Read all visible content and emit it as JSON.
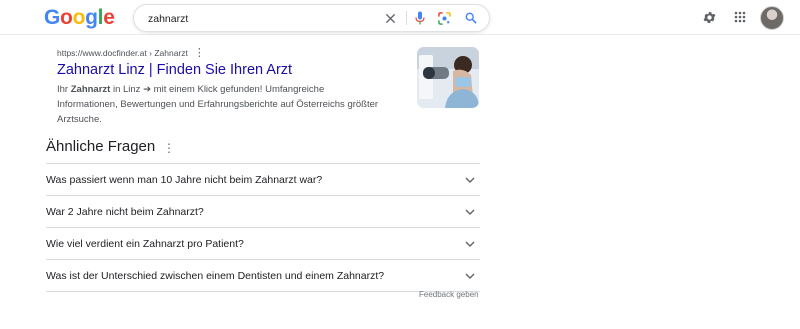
{
  "logo": {
    "letters": [
      "G",
      "o",
      "o",
      "g",
      "l",
      "e"
    ],
    "colors": [
      "#4285F4",
      "#EA4335",
      "#FBBC05",
      "#4285F4",
      "#34A853",
      "#EA4335"
    ]
  },
  "search": {
    "query": "zahnarzt"
  },
  "icons": {
    "clear": "close-icon",
    "voice": "microphone-icon",
    "lens": "google-lens-icon",
    "search": "search-icon",
    "settings": "gear-icon",
    "apps": "apps-grid-icon"
  },
  "result": {
    "url": "https://www.docfinder.at › Zahnarzt",
    "title": "Zahnarzt Linz | Finden Sie Ihren Arzt",
    "snippet_pre": "Ihr ",
    "snippet_bold": "Zahnarzt",
    "snippet_post": " in Linz ➔ mit einem Klick gefunden! Umfangreiche Informationen, Bewertungen und Erfahrungsberichte auf Österreichs größter Arztsuche."
  },
  "paa": {
    "title": "Ähnliche Fragen",
    "questions": [
      "Was passiert wenn man 10 Jahre nicht beim Zahnarzt war?",
      "War 2 Jahre nicht beim Zahnarzt?",
      "Wie viel verdient ein Zahnarzt pro Patient?",
      "Was ist der Unterschied zwischen einem Dentisten und einem Zahnarzt?"
    ]
  },
  "feedback": "Feedback geben",
  "colors": {
    "link": "#1a0dab",
    "accent": "#4285F4"
  }
}
